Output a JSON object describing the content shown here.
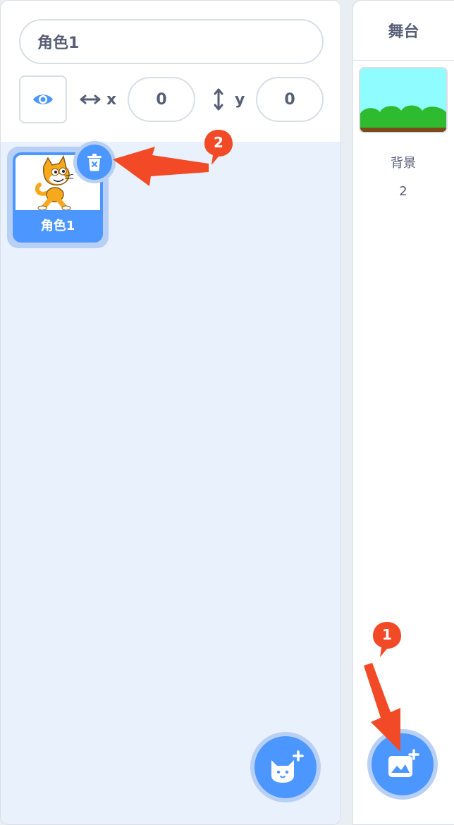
{
  "sprite_info": {
    "name_value": "角色1",
    "x_label": "x",
    "x_value": "0",
    "y_label": "y",
    "y_value": "0"
  },
  "sprites": [
    {
      "label": "角色1",
      "selected": true
    }
  ],
  "stage": {
    "header": "舞台",
    "backdrops_label": "背景",
    "backdrops_count": "2"
  },
  "annotations": {
    "callout_1": "1",
    "callout_2": "2",
    "color": "#f24a26"
  },
  "colors": {
    "accent": "#4c97ff",
    "accent_halo": "#b8d0f5",
    "list_bg": "#e9f1fc"
  },
  "icons": {
    "visibility": "eye-icon",
    "x_axis": "horizontal-arrows-icon",
    "y_axis": "vertical-arrows-icon",
    "delete": "trash-icon",
    "add_sprite": "add-sprite-icon",
    "add_backdrop": "add-backdrop-icon"
  }
}
